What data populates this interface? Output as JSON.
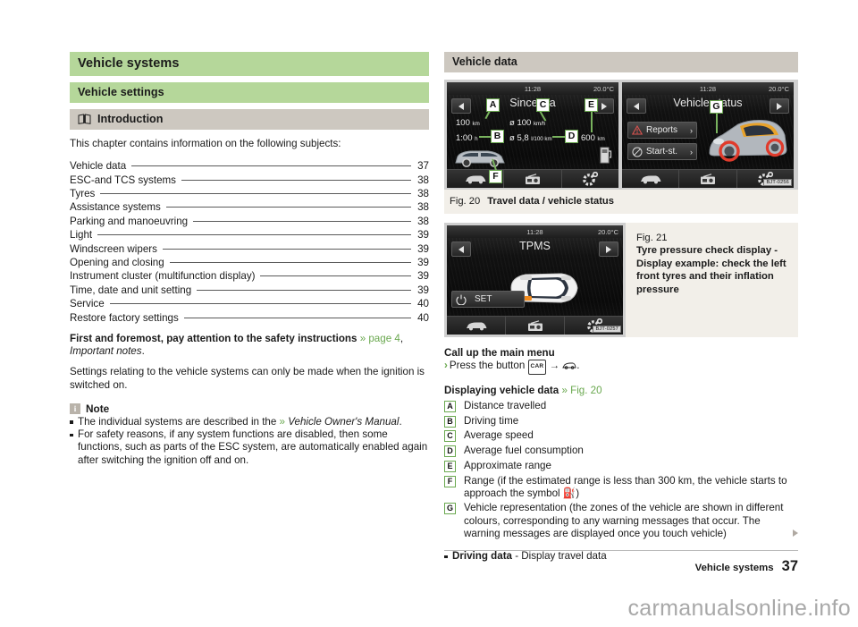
{
  "left": {
    "chapter_title": "Vehicle systems",
    "section_title": "Vehicle settings",
    "subsection_title": "Introduction",
    "intro_paragraph": "This chapter contains information on the following subjects:",
    "toc": [
      {
        "label": "Vehicle data",
        "page": "37"
      },
      {
        "label": "ESC-and TCS systems",
        "page": "38"
      },
      {
        "label": "Tyres",
        "page": "38"
      },
      {
        "label": "Assistance systems",
        "page": "38"
      },
      {
        "label": "Parking and manoeuvring",
        "page": "38"
      },
      {
        "label": "Light",
        "page": "39"
      },
      {
        "label": "Windscreen wipers",
        "page": "39"
      },
      {
        "label": "Opening and closing",
        "page": "39"
      },
      {
        "label": "Instrument cluster (multifunction display)",
        "page": "39"
      },
      {
        "label": "Time, date and unit setting",
        "page": "39"
      },
      {
        "label": "Service",
        "page": "40"
      },
      {
        "label": "Restore factory settings",
        "page": "40"
      }
    ],
    "safety_bold": "First and foremost, pay attention to the safety instructions",
    "safety_link": "» page 4",
    "safety_italic": "Important notes",
    "safety_tail": ".",
    "ignition_paragraph": "Settings relating to the vehicle systems can only be made when the ignition is switched on.",
    "note_badge": "i",
    "note_title": "Note",
    "note_items": [
      {
        "pre": "The individual systems are described in the ",
        "link": "»",
        "italic": " Vehicle Owner's Manual",
        "post": "."
      },
      {
        "pre": "For safety reasons, if any system functions are disabled, then some functions, such as parts of the ESC system, are automatically enabled again after switching the ignition off and on.",
        "link": "",
        "italic": "",
        "post": ""
      }
    ]
  },
  "right": {
    "section_title": "Vehicle data",
    "fig20": {
      "number": "Fig. 20",
      "caption": "Travel data / vehicle status",
      "bit_code": "BJT-0256",
      "left_screen": {
        "time": "11:28",
        "temperature": "20.0°C",
        "title": "Since sta",
        "distance": "100",
        "distance_unit": "km",
        "time_driven": "1:00",
        "time_unit": "h",
        "avg_speed": "ø 100",
        "avg_speed_unit": "km/h",
        "avg_consumption": "ø 5,8",
        "avg_consumption_unit": "l/100 km",
        "range": "600",
        "range_unit": "km"
      },
      "right_screen": {
        "time": "11:28",
        "temperature": "20.0°C",
        "title": "Vehicle status",
        "button_reports": "Reports",
        "button_startstop": "Start-st.",
        "chevron": "›"
      },
      "callouts": [
        "A",
        "B",
        "C",
        "D",
        "E",
        "F",
        "G"
      ]
    },
    "fig21": {
      "number": "Fig. 21",
      "caption": "Tyre pressure check display - Display example: check the left front tyres and their inflation pressure",
      "bit_code": "BJT-0257",
      "screen": {
        "time": "11:28",
        "temperature": "20.0°C",
        "title": "TPMS",
        "set_button": "SET"
      }
    },
    "call_main_menu_title": "Call up the main menu",
    "call_main_menu_step_pre": "Press the button",
    "call_main_menu_key": "CAR",
    "call_main_menu_arrow": "→",
    "call_main_menu_tail": ".",
    "display_data_title": "Displaying vehicle data",
    "display_data_link": "» Fig. 20",
    "definitions": [
      {
        "key": "A",
        "text": "Distance travelled"
      },
      {
        "key": "B",
        "text": "Driving time"
      },
      {
        "key": "C",
        "text": "Average speed"
      },
      {
        "key": "D",
        "text": "Average fuel consumption"
      },
      {
        "key": "E",
        "text": "Approximate range"
      },
      {
        "key": "F",
        "text": "Range (if the estimated range is less than 300 km, the vehicle starts to approach the symbol ⛽)"
      },
      {
        "key": "G",
        "text": "Vehicle representation (the zones of the vehicle are shown in different colours, corresponding to any warning messages that occur. The warning messages are displayed once you touch vehicle)"
      }
    ],
    "driving_data_bold": "Driving data",
    "driving_data_rest": " - Display travel data"
  },
  "footer": {
    "label": "Vehicle systems",
    "page": "37"
  },
  "watermark": "carmanualsonline.info",
  "colors": {
    "banner_green": "#b5d79a",
    "banner_grey": "#cdc8c0",
    "link_green": "#6aa84f",
    "figure_bg": "#f2efe9"
  }
}
